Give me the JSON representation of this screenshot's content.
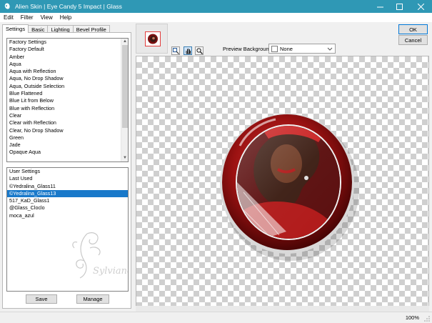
{
  "window": {
    "title": "Alien Skin | Eye Candy 5 Impact | Glass",
    "controls": {
      "minimize": "—",
      "maximize": "☐",
      "close": "✕"
    }
  },
  "menu": [
    "Edit",
    "Filter",
    "View",
    "Help"
  ],
  "tabs": [
    "Settings",
    "Basic",
    "Lighting",
    "Bevel Profile"
  ],
  "factory_settings": {
    "header": "Factory Settings",
    "items": [
      "Factory Default",
      "Amber",
      "Aqua",
      "Aqua with Reflection",
      "Aqua, No Drop Shadow",
      "Aqua, Outside Selection",
      "Blue Flattened",
      "Blue Lit from Below",
      "Blue with Reflection",
      "Clear",
      "Clear with Reflection",
      "Clear, No Drop Shadow",
      "Green",
      "Jade",
      "Opaque Aqua"
    ]
  },
  "user_settings": {
    "header": "User Settings",
    "items": [
      "Last Used",
      "©Yedralina_Glass11",
      "©Yedralina_Glass13",
      "517_KaD_Glass1",
      "@Glass_Cloclo",
      "moca_azul"
    ],
    "selected": "©Yedralina_Glass13",
    "watermark_text": "Sylviane"
  },
  "buttons": {
    "save": "Save",
    "manage": "Manage",
    "ok": "OK",
    "cancel": "Cancel"
  },
  "preview": {
    "background_label": "Preview Background:",
    "background_value": "None",
    "tools": [
      "zoom-rect-icon",
      "hand-icon",
      "magnifier-icon"
    ],
    "active_tool": "hand-icon"
  },
  "status": {
    "zoom": "100%"
  },
  "colors": {
    "titlebar": "#2f98b5",
    "selection": "#1979ca",
    "accent_red": "#b01818"
  }
}
